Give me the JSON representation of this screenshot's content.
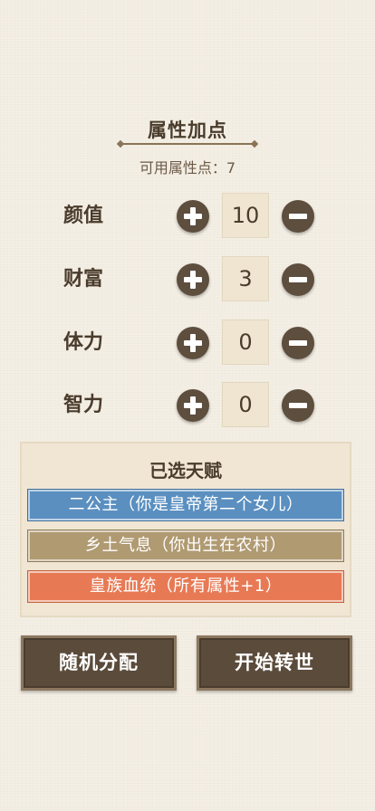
{
  "header": {
    "title": "属性加点",
    "available_points_text": "可用属性点：7"
  },
  "attributes": [
    {
      "label": "颜值",
      "value": "10"
    },
    {
      "label": "财富",
      "value": "3"
    },
    {
      "label": "体力",
      "value": "0"
    },
    {
      "label": "智力",
      "value": "0"
    }
  ],
  "talents": {
    "title": "已选天赋",
    "items": [
      {
        "text": "二公主（你是皇帝第二个女儿）",
        "color": "#5a8fc0"
      },
      {
        "text": "乡土气息（你出生在农村）",
        "color": "#b09a72"
      },
      {
        "text": "皇族血统（所有属性+1）",
        "color": "#e77a55"
      }
    ]
  },
  "actions": {
    "random_label": "随机分配",
    "start_label": "开始转世"
  },
  "icons": {
    "plus": "plus-circle-icon",
    "minus": "minus-circle-icon"
  }
}
